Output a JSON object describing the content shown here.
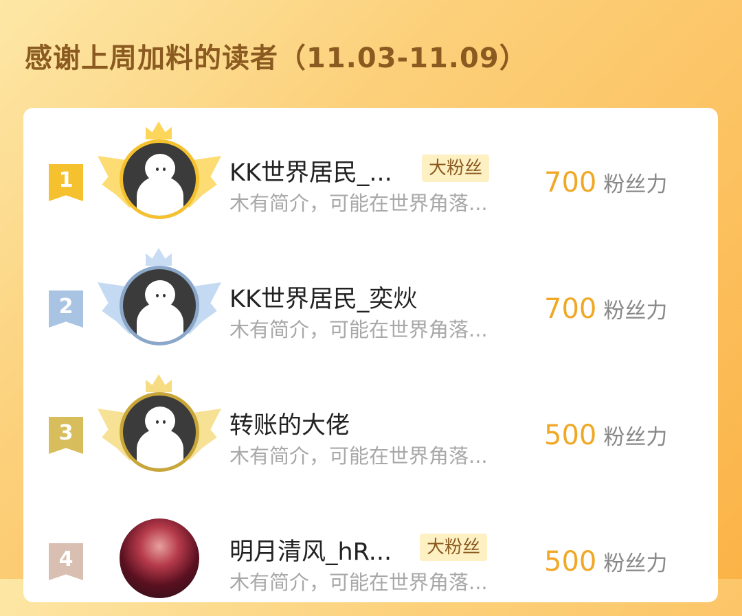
{
  "title": "感谢上周加料的读者（11.03-11.09）",
  "rows": [
    {
      "rank": "1",
      "name": "KK世界居民_...",
      "badge": "大粉丝",
      "desc": "木有简介，可能在世界角落...",
      "score": "700",
      "unit": "粉丝力",
      "color": "#f5c12e",
      "wing": "#fcd65a"
    },
    {
      "rank": "2",
      "name": "KK世界居民_奕炏",
      "badge": "",
      "desc": "木有简介，可能在世界角落...",
      "score": "700",
      "unit": "粉丝力",
      "color": "#8aa7c9",
      "wing": "#b9d3f0"
    },
    {
      "rank": "3",
      "name": "转账的大佬",
      "badge": "",
      "desc": "木有简介，可能在世界角落...",
      "score": "500",
      "unit": "粉丝力",
      "color": "#c9a63a",
      "wing": "#f6dc82"
    },
    {
      "rank": "4",
      "name": "明月清风_hR...",
      "badge": "大粉丝",
      "desc": "木有简介，可能在世界角落...",
      "score": "500",
      "unit": "粉丝力",
      "color": "#cfa896",
      "wing": ""
    }
  ]
}
